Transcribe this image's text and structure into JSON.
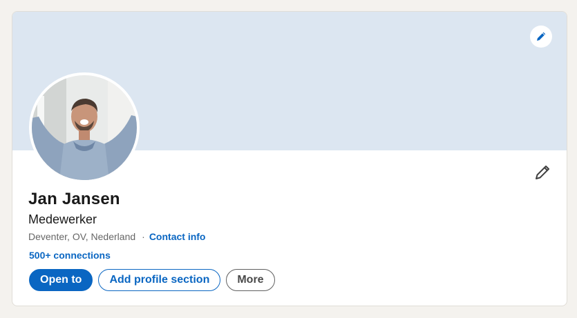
{
  "profile": {
    "name": "Jan Jansen",
    "headline": "Medewerker",
    "location": "Deventer, OV, Nederland",
    "separator": "·",
    "contact_info_label": "Contact info",
    "connections_label": "500+ connections"
  },
  "actions": {
    "open_to_label": "Open to",
    "add_section_label": "Add profile section",
    "more_label": "More"
  },
  "icons": {
    "banner_edit": "pencil-icon",
    "profile_edit": "pencil-icon"
  },
  "colors": {
    "accent": "#0a66c2",
    "banner": "#dce6f1",
    "page_background": "#f4f2ee",
    "text": "#191919",
    "muted_text": "#666666"
  }
}
